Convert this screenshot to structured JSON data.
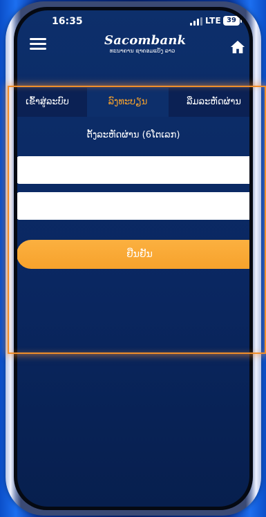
{
  "status_bar": {
    "time": "16:35",
    "network": "LTE",
    "battery": "39"
  },
  "header": {
    "brand_name": "Sacombank",
    "brand_subtitle": "ທະນາຄານ ຊາຄອມແບັງ ລາວ",
    "menu_icon": "hamburger-menu-icon",
    "home_icon": "home-icon"
  },
  "tabs": [
    {
      "label": "ເຂົ້າສູ່ລະບົບ",
      "active": false
    },
    {
      "label": "ລົງທະບຽນ",
      "active": true
    },
    {
      "label": "ລືມລະຫັດຜ່ານ",
      "active": false
    }
  ],
  "form": {
    "title": "ຕັ້ງລະຫັດຜ່ານ (6ໂຕເລກ)",
    "password_value": "",
    "confirm_password_value": "",
    "confirm_button": "ຢືນຢັນ"
  },
  "colors": {
    "accent": "#f7a22c",
    "highlight_frame": "#f28f2a",
    "screen_bg": "#0a2761"
  }
}
